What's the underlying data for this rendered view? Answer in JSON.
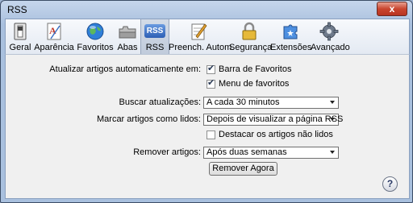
{
  "window": {
    "title": "RSS",
    "close_label": "x"
  },
  "toolbar": {
    "items": [
      {
        "label": "Geral",
        "icon": "switch-icon"
      },
      {
        "label": "Aparência",
        "icon": "font-icon"
      },
      {
        "label": "Favoritos",
        "icon": "globe-icon"
      },
      {
        "label": "Abas",
        "icon": "tabs-icon"
      },
      {
        "label": "RSS",
        "icon": "rss-icon",
        "badge": "RSS",
        "selected": true
      },
      {
        "label": "Preench. Autom.",
        "icon": "pen-icon"
      },
      {
        "label": "Segurança",
        "icon": "lock-icon"
      },
      {
        "label": "Extensões",
        "icon": "puzzle-icon"
      },
      {
        "label": "Avançado",
        "icon": "gear-icon"
      }
    ]
  },
  "settings": {
    "auto_update_label": "Atualizar artigos automaticamente em:",
    "favorites_bar_label": "Barra de Favoritos",
    "favorites_bar_checked": true,
    "favorites_menu_label": "Menu de favoritos",
    "favorites_menu_checked": true,
    "check_label": "Buscar atualizações:",
    "check_value": "A cada 30 minutos",
    "mark_read_label": "Marcar artigos como lidos:",
    "mark_read_value": "Depois de visualizar a página RSS",
    "highlight_label": "Destacar os artigos não lidos",
    "highlight_checked": false,
    "remove_label": "Remover artigos:",
    "remove_value": "Após duas semanas",
    "remove_now_label": "Remover Agora",
    "help_label": "?",
    "checkmark": "✔"
  }
}
